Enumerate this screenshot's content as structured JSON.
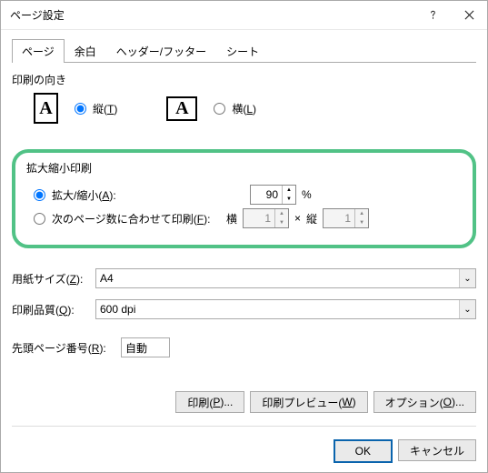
{
  "titlebar": {
    "title": "ページ設定"
  },
  "tabs": {
    "page": "ページ",
    "margins": "余白",
    "headerfooter": "ヘッダー/フッター",
    "sheet": "シート"
  },
  "orient": {
    "label": "印刷の向き",
    "portrait": "縦(T)",
    "landscape": "横(L)"
  },
  "scaling": {
    "group_title": "拡大縮小印刷",
    "adjust_label": "拡大/縮小(A):",
    "adjust_value": "90",
    "adjust_suffix": "%",
    "fit_label": "次のページ数に合わせて印刷(F):",
    "fit_wide_label": "横",
    "fit_wide_value": "1",
    "fit_cross": "×",
    "fit_tall_label": "縦",
    "fit_tall_value": "1"
  },
  "paper": {
    "size_label": "用紙サイズ(Z):",
    "size_value": "A4",
    "quality_label": "印刷品質(Q):",
    "quality_value": "600 dpi"
  },
  "firstpage": {
    "label": "先頭ページ番号(R):",
    "value": "自動"
  },
  "buttons": {
    "print": "印刷(P)...",
    "preview": "印刷プレビュー(W)",
    "options": "オプション(O)...",
    "ok": "OK",
    "cancel": "キャンセル"
  }
}
